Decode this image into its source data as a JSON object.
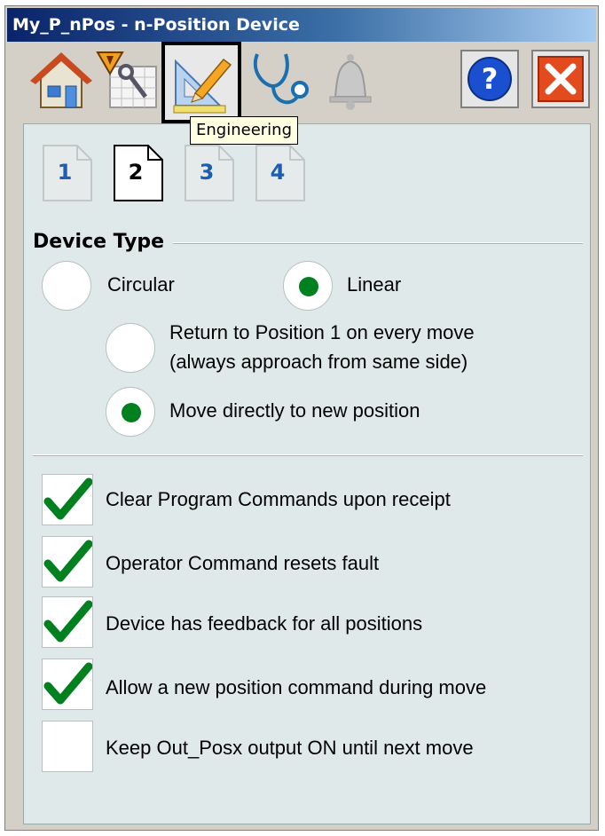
{
  "window": {
    "title": "My_P_nPos - n-Position Device"
  },
  "toolbar": {
    "tooltip": "Engineering",
    "icons": [
      "home-icon",
      "maintenance-icon",
      "engineering-icon",
      "diagnostics-icon",
      "alarm-bell-icon",
      "help-icon",
      "close-icon"
    ]
  },
  "tabs": [
    {
      "label": "1",
      "active": false
    },
    {
      "label": "2",
      "active": true
    },
    {
      "label": "3",
      "active": false
    },
    {
      "label": "4",
      "active": false
    }
  ],
  "device_type": {
    "title": "Device Type",
    "circular": {
      "label": "Circular",
      "selected": false
    },
    "linear": {
      "label": "Linear",
      "selected": true
    },
    "return_option": {
      "line1": "Return to Position 1 on every move",
      "line2": "(always approach from same side)",
      "selected": false
    },
    "direct_option": {
      "label": "Move directly to new position",
      "selected": true
    }
  },
  "options": [
    {
      "label": "Clear Program Commands upon receipt",
      "checked": true
    },
    {
      "label": "Operator Command resets fault",
      "checked": true
    },
    {
      "label": "Device has feedback for all positions",
      "checked": true
    },
    {
      "label": "Allow a new position command during move",
      "checked": true
    },
    {
      "label": "Keep Out_Posx output ON until next move",
      "checked": false
    }
  ],
  "colors": {
    "check_green": "#00801f",
    "tab_blue": "#1a5fb4",
    "close_red": "#e34b1f"
  }
}
